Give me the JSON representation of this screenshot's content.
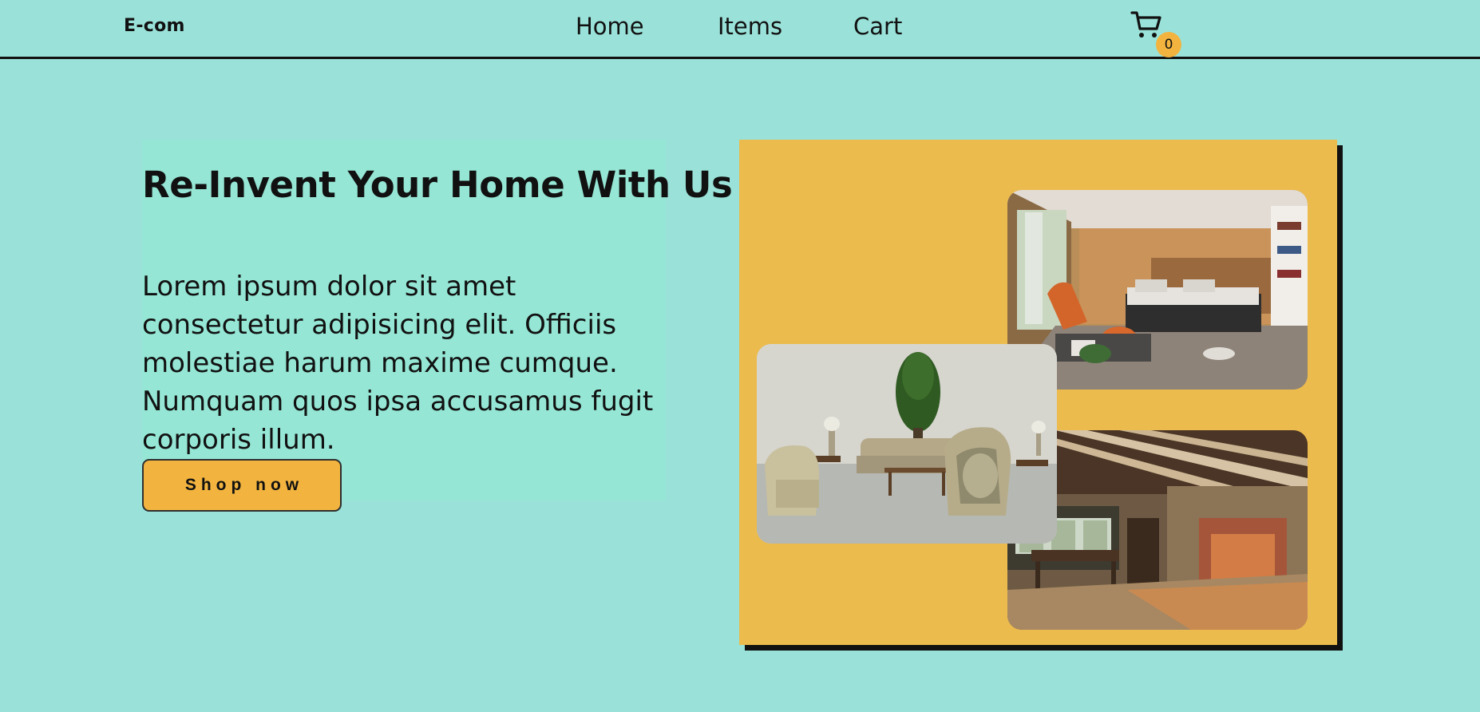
{
  "header": {
    "brand": "E-com",
    "nav": {
      "home": "Home",
      "items": "Items",
      "cart": "Cart"
    },
    "cart_icon": "shopping-cart-icon",
    "cart_count": "0"
  },
  "hero": {
    "title": "Re-Invent Your Home With Us",
    "body": "Lorem ipsum dolor sit amet consectetur adipisicing elit. Officiis molestiae harum maxime cumque. Numquam quos ipsa accusamus fugit corporis illum.",
    "cta_label": "Shop now"
  },
  "gallery": {
    "images": [
      {
        "subject": "bedroom interior photo"
      },
      {
        "subject": "living room interior photo"
      },
      {
        "subject": "fireplace dining hall photo"
      }
    ]
  },
  "colors": {
    "background": "#9ae2d9",
    "hero_panel": "#95e6d5",
    "accent": "#f2b43f",
    "gallery_panel": "#ecbb4e",
    "text": "#111111"
  }
}
